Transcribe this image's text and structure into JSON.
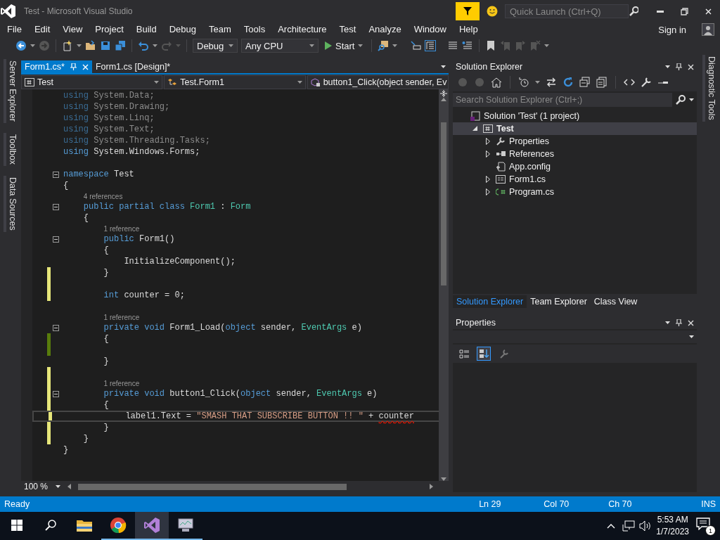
{
  "window": {
    "title": "Test - Microsoft Visual Studio",
    "quick_launch": {
      "placeholder": "Quick Launch (Ctrl+Q)"
    }
  },
  "menu": {
    "items": [
      "File",
      "Edit",
      "View",
      "Project",
      "Build",
      "Debug",
      "Team",
      "Tools",
      "Architecture",
      "Test",
      "Analyze",
      "Window",
      "Help"
    ],
    "sign_in": "Sign in"
  },
  "toolbar": {
    "configuration": "Debug",
    "platform": "Any CPU",
    "start": "Start"
  },
  "left_dock": [
    "Server Explorer",
    "Toolbox",
    "Data Sources"
  ],
  "right_dock": [
    "Diagnostic Tools"
  ],
  "editor": {
    "tabs": [
      {
        "label": "Form1.cs*",
        "selected": true
      },
      {
        "label": "Form1.cs [Design]*",
        "selected": false
      }
    ],
    "nav": [
      "Test",
      "Test.Form1",
      "button1_Click(object sender, Ev"
    ],
    "lines": [
      {
        "kind": "code",
        "fold": false,
        "unsaved": false,
        "saved": false,
        "current": false,
        "tokens": [
          {
            "kind": "kw-dim",
            "t": "using"
          },
          {
            "kind": "dim",
            "t": " System.Data;"
          }
        ]
      },
      {
        "kind": "code",
        "fold": false,
        "unsaved": false,
        "saved": false,
        "current": false,
        "tokens": [
          {
            "kind": "kw-dim",
            "t": "using"
          },
          {
            "kind": "dim",
            "t": " System.Drawing;"
          }
        ]
      },
      {
        "kind": "code",
        "fold": false,
        "unsaved": false,
        "saved": false,
        "current": false,
        "tokens": [
          {
            "kind": "kw-dim",
            "t": "using"
          },
          {
            "kind": "dim",
            "t": " System.Linq;"
          }
        ]
      },
      {
        "kind": "code",
        "fold": false,
        "unsaved": false,
        "saved": false,
        "current": false,
        "tokens": [
          {
            "kind": "kw-dim",
            "t": "using"
          },
          {
            "kind": "dim",
            "t": " System.Text;"
          }
        ]
      },
      {
        "kind": "code",
        "fold": false,
        "unsaved": false,
        "saved": false,
        "current": false,
        "tokens": [
          {
            "kind": "kw-dim",
            "t": "using"
          },
          {
            "kind": "dim",
            "t": " System.Threading.Tasks;"
          }
        ]
      },
      {
        "kind": "code",
        "fold": false,
        "unsaved": false,
        "saved": false,
        "current": false,
        "tokens": [
          {
            "kind": "kw",
            "t": "using"
          },
          {
            "kind": "plain",
            "t": " System.Windows.Forms;"
          }
        ]
      },
      {
        "kind": "blank",
        "fold": false,
        "unsaved": false,
        "saved": false,
        "current": false
      },
      {
        "kind": "code",
        "fold": true,
        "unsaved": false,
        "saved": false,
        "current": false,
        "tokens": [
          {
            "kind": "kw",
            "t": "namespace"
          },
          {
            "kind": "plain",
            "t": " Test"
          }
        ]
      },
      {
        "kind": "code",
        "fold": false,
        "unsaved": false,
        "saved": false,
        "current": false,
        "tokens": [
          {
            "kind": "plain",
            "t": "{"
          }
        ]
      },
      {
        "kind": "lens",
        "fold": false,
        "unsaved": false,
        "saved": false,
        "current": false,
        "text": "4 references"
      },
      {
        "kind": "code",
        "fold": true,
        "unsaved": false,
        "saved": false,
        "current": false,
        "tokens": [
          {
            "kind": "kw",
            "t": "    public partial class"
          },
          {
            "kind": "type",
            "t": " Form1"
          },
          {
            "kind": "plain",
            "t": " : "
          },
          {
            "kind": "type",
            "t": "Form"
          }
        ]
      },
      {
        "kind": "code",
        "fold": false,
        "unsaved": false,
        "saved": false,
        "current": false,
        "tokens": [
          {
            "kind": "plain",
            "t": "    {"
          }
        ]
      },
      {
        "kind": "lens",
        "fold": false,
        "unsaved": false,
        "saved": false,
        "current": false,
        "text": "1 reference"
      },
      {
        "kind": "code",
        "fold": true,
        "unsaved": false,
        "saved": false,
        "current": false,
        "tokens": [
          {
            "kind": "kw",
            "t": "        public"
          },
          {
            "kind": "plain",
            "t": " Form1()"
          }
        ]
      },
      {
        "kind": "code",
        "fold": false,
        "unsaved": false,
        "saved": false,
        "current": false,
        "tokens": [
          {
            "kind": "plain",
            "t": "        {"
          }
        ]
      },
      {
        "kind": "code",
        "fold": false,
        "unsaved": false,
        "saved": false,
        "current": false,
        "tokens": [
          {
            "kind": "plain",
            "t": "            InitializeComponent();"
          }
        ]
      },
      {
        "kind": "code",
        "fold": false,
        "unsaved": true,
        "saved": false,
        "current": false,
        "tokens": [
          {
            "kind": "plain",
            "t": "        }"
          }
        ]
      },
      {
        "kind": "blank",
        "fold": false,
        "unsaved": true,
        "saved": false,
        "current": false
      },
      {
        "kind": "code",
        "fold": false,
        "unsaved": true,
        "saved": false,
        "current": false,
        "tokens": [
          {
            "kind": "kw",
            "t": "        int"
          },
          {
            "kind": "plain",
            "t": " counter = 0;"
          }
        ]
      },
      {
        "kind": "blank",
        "fold": false,
        "unsaved": false,
        "saved": false,
        "current": false
      },
      {
        "kind": "lens",
        "fold": false,
        "unsaved": false,
        "saved": false,
        "current": false,
        "text": "1 reference"
      },
      {
        "kind": "code",
        "fold": true,
        "unsaved": false,
        "saved": false,
        "current": false,
        "tokens": [
          {
            "kind": "kw",
            "t": "        private void"
          },
          {
            "kind": "plain",
            "t": " Form1_Load("
          },
          {
            "kind": "kw",
            "t": "object"
          },
          {
            "kind": "plain",
            "t": " sender, "
          },
          {
            "kind": "type",
            "t": "EventArgs"
          },
          {
            "kind": "plain",
            "t": " e)"
          }
        ]
      },
      {
        "kind": "code",
        "fold": false,
        "unsaved": false,
        "saved": true,
        "current": false,
        "tokens": [
          {
            "kind": "plain",
            "t": "        {"
          }
        ]
      },
      {
        "kind": "blank",
        "fold": false,
        "unsaved": false,
        "saved": true,
        "current": false
      },
      {
        "kind": "code",
        "fold": false,
        "unsaved": false,
        "saved": false,
        "current": false,
        "tokens": [
          {
            "kind": "plain",
            "t": "        }"
          }
        ]
      },
      {
        "kind": "blank",
        "fold": false,
        "unsaved": true,
        "saved": false,
        "current": false
      },
      {
        "kind": "lens",
        "fold": false,
        "unsaved": true,
        "saved": false,
        "current": false,
        "text": "1 reference"
      },
      {
        "kind": "code",
        "fold": true,
        "unsaved": true,
        "saved": false,
        "current": false,
        "tokens": [
          {
            "kind": "kw",
            "t": "        private void"
          },
          {
            "kind": "plain",
            "t": " button1_Click("
          },
          {
            "kind": "kw",
            "t": "object"
          },
          {
            "kind": "plain",
            "t": " sender, "
          },
          {
            "kind": "type",
            "t": "EventArgs"
          },
          {
            "kind": "plain",
            "t": " e)"
          }
        ]
      },
      {
        "kind": "code",
        "fold": false,
        "unsaved": true,
        "saved": false,
        "current": false,
        "tokens": [
          {
            "kind": "plain",
            "t": "        {"
          }
        ]
      },
      {
        "kind": "code",
        "fold": false,
        "unsaved": true,
        "saved": false,
        "current": true,
        "tokens": [
          {
            "kind": "plain",
            "t": "            label1.Text = "
          },
          {
            "kind": "str",
            "t": "\"SMASH THAT SUBSCRIBE BUTTON !! \""
          },
          {
            "kind": "plain",
            "t": " + "
          },
          {
            "kind": "plain",
            "t": "counter",
            "error": true
          }
        ]
      },
      {
        "kind": "code",
        "fold": false,
        "unsaved": true,
        "saved": false,
        "current": false,
        "tokens": [
          {
            "kind": "plain",
            "t": "        }"
          }
        ]
      },
      {
        "kind": "code",
        "fold": false,
        "unsaved": true,
        "saved": false,
        "current": false,
        "tokens": [
          {
            "kind": "plain",
            "t": "    }"
          }
        ]
      },
      {
        "kind": "code",
        "fold": false,
        "unsaved": false,
        "saved": false,
        "current": false,
        "tokens": [
          {
            "kind": "plain",
            "t": "}"
          }
        ]
      }
    ],
    "zoom": "100 %"
  },
  "solution_explorer": {
    "title": "Solution Explorer",
    "search": {
      "placeholder": "Search Solution Explorer (Ctrl+;)"
    },
    "tree": [
      {
        "label": "Solution 'Test' (1 project)",
        "kind": "solution",
        "expandable": false,
        "selected": false,
        "children": [
          {
            "label": "Test",
            "kind": "project",
            "expandable": true,
            "expanded": true,
            "selected": true,
            "children": [
              {
                "label": "Properties",
                "kind": "properties",
                "expandable": true,
                "expanded": false,
                "selected": false
              },
              {
                "label": "References",
                "kind": "references",
                "expandable": true,
                "expanded": false,
                "selected": false
              },
              {
                "label": "App.config",
                "kind": "config",
                "expandable": false,
                "selected": false
              },
              {
                "label": "Form1.cs",
                "kind": "form",
                "expandable": true,
                "expanded": false,
                "selected": false
              },
              {
                "label": "Program.cs",
                "kind": "csharp",
                "expandable": true,
                "expanded": false,
                "selected": false
              }
            ]
          }
        ]
      }
    ]
  },
  "dock_tabs": [
    {
      "label": "Solution Explorer",
      "selected": true
    },
    {
      "label": "Team Explorer",
      "selected": false
    },
    {
      "label": "Class View",
      "selected": false
    }
  ],
  "properties": {
    "title": "Properties",
    "buttons": [
      {
        "kind": "categorized",
        "selected": false
      },
      {
        "kind": "alphabetical",
        "selected": true
      },
      {
        "kind": "pages",
        "selected": false
      }
    ]
  },
  "status_bar": {
    "message": "Ready",
    "line": "Ln 29",
    "column": "Col 70",
    "char": "Ch 70",
    "mode": "INS"
  },
  "taskbar": {
    "apps": [
      {
        "kind": "explorer",
        "running": false,
        "selected": false
      },
      {
        "kind": "chrome",
        "running": true,
        "selected": false
      },
      {
        "kind": "vs",
        "running": true,
        "selected": true
      },
      {
        "kind": "monitor",
        "running": true,
        "selected": false
      }
    ],
    "time": "5:53 AM",
    "date": "1/7/2023",
    "notifications": "1"
  }
}
